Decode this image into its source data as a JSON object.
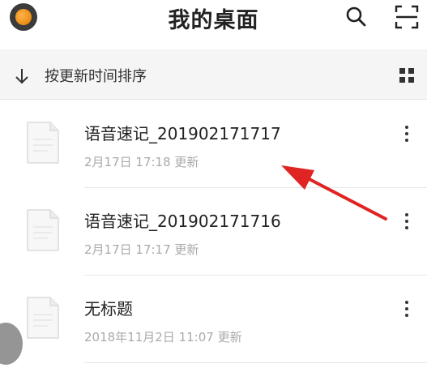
{
  "header": {
    "title": "我的桌面"
  },
  "sortbar": {
    "label": "按更新时间排序"
  },
  "items": [
    {
      "title": "语音速记_201902171717",
      "meta": "2月17日 17:18  更新"
    },
    {
      "title": "语音速记_201902171716",
      "meta": "2月17日 17:17  更新"
    },
    {
      "title": "无标题",
      "meta": "2018年11月2日 11:07  更新"
    }
  ],
  "colors": {
    "annotation_arrow": "#e02424",
    "accent_avatar": "#f39a1e"
  },
  "icons": [
    "avatar",
    "search-icon",
    "scan-icon",
    "sort-down-arrow-icon",
    "grid-view-icon",
    "document-icon",
    "more-vertical-icon"
  ]
}
